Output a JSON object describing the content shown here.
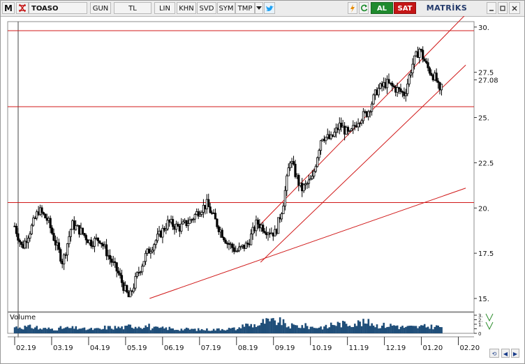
{
  "toolbar": {
    "app_logo": "M",
    "symbol": "TOASO",
    "period_button": "GUN",
    "currency_button": "TL",
    "scale_button": "LIN",
    "khn_button": "KHN",
    "svd_button": "SVD",
    "sym_button": "SYM",
    "tmp_button": "TMP",
    "dropdown_icon": "chevron-down-icon",
    "twitter_icon": "twitter-icon",
    "bolt_icon": "lightning-icon",
    "refresh_icon": "refresh-icon",
    "buy_button": "AL",
    "sell_button": "SAT",
    "brand": "MATRİKS",
    "minimize_icon": "minimize-icon",
    "maximize_icon": "maximize-icon",
    "close_icon": "close-icon"
  },
  "colors": {
    "up_candle": "#ffffff",
    "down_candle": "#000000",
    "trendline": "#d01818",
    "volume_bar": "#1f4e79",
    "grid_line": "#c0c0c0",
    "volume_axis_green": "#2f8f2f"
  },
  "volume": {
    "label": "Volume",
    "axis_ticks": [
      "3.",
      "2.",
      "1.",
      "",
      "0"
    ]
  },
  "nav": {
    "reset_icon": "refresh-icon",
    "left_icon": "arrow-left-icon",
    "right_icon": "arrow-right-icon"
  },
  "chart_data": {
    "type": "candlestick",
    "title": "TOASO",
    "x_ticks": [
      "02.19",
      "03.19",
      "04.19",
      "05.19",
      "06.19",
      "07.19",
      "08.19",
      "09.19",
      "10.19",
      "11.19",
      "12.19",
      "01.20",
      "02.20"
    ],
    "y_ticks": [
      "30.",
      "27.5",
      "25.",
      "22.5",
      "20.",
      "17.5",
      "15."
    ],
    "y_tick_values": [
      30,
      27.5,
      25,
      22.5,
      20,
      17.5,
      15
    ],
    "ylim": [
      14.5,
      30.3
    ],
    "last_price_label": "27.08",
    "last_price": 27.08,
    "horizontal_lines": [
      29.8,
      25.6,
      20.3
    ],
    "trend_lines": [
      {
        "from": [
          "05.19",
          15.0
        ],
        "to": [
          "02.20",
          21.1
        ]
      },
      {
        "from": [
          "08.19",
          17.0
        ],
        "to": [
          "02.20",
          27.9
        ]
      },
      {
        "from": [
          "08.19",
          19.1
        ],
        "to": [
          "02.20",
          30.7
        ]
      }
    ],
    "price_path": [
      [
        0.0,
        19.0
      ],
      [
        0.2,
        17.8
      ],
      [
        0.45,
        18.9
      ],
      [
        0.65,
        19.9
      ],
      [
        0.9,
        19.3
      ],
      [
        1.1,
        18.1
      ],
      [
        1.3,
        17.0
      ],
      [
        1.55,
        19.1
      ],
      [
        1.8,
        18.7
      ],
      [
        2.05,
        18.1
      ],
      [
        2.3,
        18.3
      ],
      [
        2.55,
        17.3
      ],
      [
        2.8,
        16.4
      ],
      [
        3.0,
        15.4
      ],
      [
        3.1,
        15.0
      ],
      [
        3.3,
        16.2
      ],
      [
        3.55,
        17.4
      ],
      [
        3.85,
        18.3
      ],
      [
        4.15,
        19.2
      ],
      [
        4.45,
        18.9
      ],
      [
        4.75,
        19.3
      ],
      [
        5.0,
        19.9
      ],
      [
        5.2,
        20.2
      ],
      [
        5.5,
        19.0
      ],
      [
        5.75,
        18.1
      ],
      [
        6.0,
        17.6
      ],
      [
        6.3,
        18.0
      ],
      [
        6.55,
        19.2
      ],
      [
        6.8,
        18.8
      ],
      [
        7.05,
        18.6
      ],
      [
        7.25,
        20.1
      ],
      [
        7.45,
        22.7
      ],
      [
        7.75,
        21.0
      ],
      [
        8.05,
        21.6
      ],
      [
        8.3,
        24.0
      ],
      [
        8.55,
        23.8
      ],
      [
        8.8,
        24.6
      ],
      [
        9.05,
        24.0
      ],
      [
        9.3,
        24.9
      ],
      [
        9.55,
        25.3
      ],
      [
        9.8,
        26.5
      ],
      [
        10.05,
        26.9
      ],
      [
        10.3,
        26.6
      ],
      [
        10.55,
        26.3
      ],
      [
        10.75,
        27.9
      ],
      [
        10.95,
        28.8
      ],
      [
        11.15,
        27.8
      ],
      [
        11.4,
        27.1
      ],
      [
        11.5,
        26.3
      ],
      [
        11.58,
        27.08
      ]
    ],
    "volume_profile": [
      0.3,
      0.22,
      0.25,
      0.2,
      0.28,
      0.35,
      0.24,
      0.2,
      0.18,
      0.22,
      0.4,
      0.55,
      0.35,
      0.3,
      0.45,
      0.5,
      0.38,
      0.3,
      0.32,
      0.95
    ]
  }
}
